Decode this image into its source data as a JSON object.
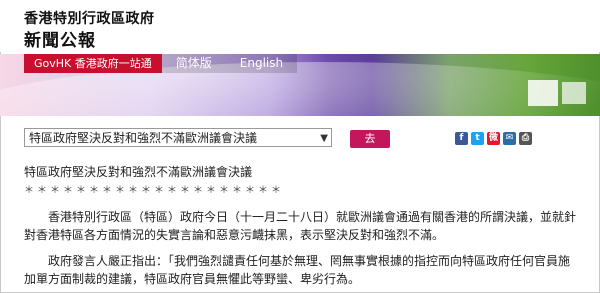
{
  "header": {
    "title_small": "香港特別行政區政府",
    "title_large": "新聞公報"
  },
  "nav": {
    "govhk_label": "GovHK 香港政府一站通",
    "simplified_label": "简体版",
    "english_label": "English"
  },
  "topic_select": {
    "value": "特區政府堅決反對和強烈不滿歐洲議會決議"
  },
  "go_button": {
    "label": "去"
  },
  "social": [
    {
      "name": "facebook",
      "glyph": "f",
      "color": "#3b5998"
    },
    {
      "name": "twitter",
      "glyph": "t",
      "color": "#1da1f2"
    },
    {
      "name": "weibo",
      "glyph": "微",
      "color": "#e6162d"
    },
    {
      "name": "email",
      "glyph": "✉",
      "color": "#2e6da4"
    },
    {
      "name": "print",
      "glyph": "⎙",
      "color": "#555555"
    }
  ],
  "article": {
    "headline": "特區政府堅決反對和強烈不滿歐洲議會決議",
    "separator": "＊＊＊＊＊＊＊＊＊＊＊＊＊＊＊＊＊＊＊＊",
    "para1": "　　香港特別行政區（特區）政府今日（十一月二十八日）就歐洲議會通過有關香港的所謂決議，並就針對香港特區各方面情況的失實言論和惡意污衊抹黑，表示堅決反對和強烈不滿。",
    "para2": "　　政府發言人嚴正指出：「我們強烈譴責任何基於無理、罔無事實根據的指控而向特區政府任何官員施加單方面制裁的建議，特區政府官員無懼此等野蠻、卑劣行為。"
  }
}
